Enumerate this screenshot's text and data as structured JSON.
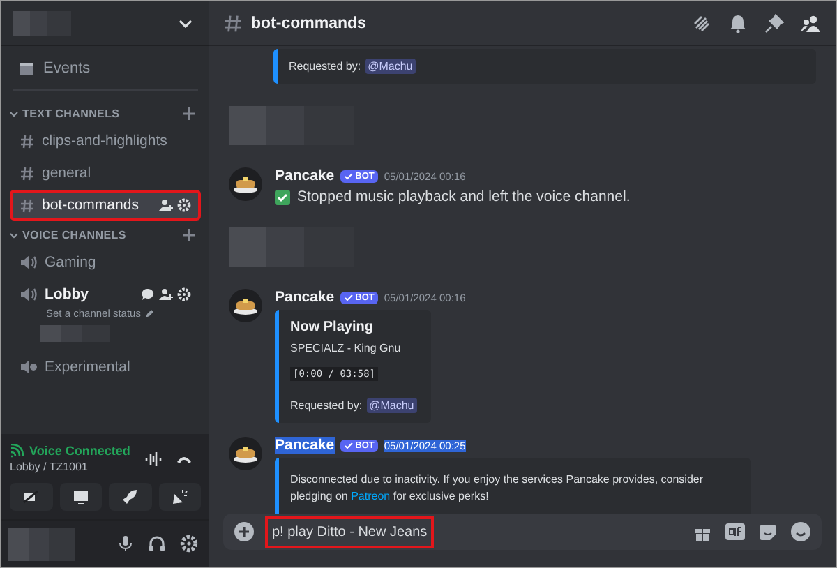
{
  "sidebar": {
    "events": "Events",
    "categories": [
      {
        "label": "TEXT CHANNELS",
        "channels": [
          {
            "kind": "text",
            "name": "clips-and-highlights",
            "selected": false,
            "highlighted": false,
            "connected": false
          },
          {
            "kind": "text",
            "name": "general",
            "selected": false,
            "highlighted": false,
            "connected": false
          },
          {
            "kind": "text",
            "name": "bot-commands",
            "selected": true,
            "highlighted": true,
            "connected": false
          }
        ]
      },
      {
        "label": "VOICE CHANNELS",
        "channels": [
          {
            "kind": "voice",
            "name": "Gaming",
            "selected": false,
            "highlighted": false,
            "connected": false
          },
          {
            "kind": "voice",
            "name": "Lobby",
            "selected": false,
            "highlighted": false,
            "connected": true,
            "status": "Set a channel status"
          },
          {
            "kind": "stage",
            "name": "Experimental",
            "selected": false,
            "highlighted": false,
            "connected": false
          }
        ]
      }
    ]
  },
  "voice_panel": {
    "status": "Voice Connected",
    "location": "Lobby / TZ1001"
  },
  "header": {
    "channel": "bot-commands"
  },
  "messages": [
    {
      "kind": "embed_tail",
      "label": "Requested by:",
      "mention": "@Machu"
    },
    {
      "kind": "hidden"
    },
    {
      "kind": "bot",
      "author": "Pancake",
      "badge": "BOT",
      "time": "05/01/2024 00:16",
      "text_selected": false,
      "content": "Stopped music playback and left the voice channel."
    },
    {
      "kind": "hidden"
    },
    {
      "kind": "bot",
      "author": "Pancake",
      "badge": "BOT",
      "time": "05/01/2024 00:16",
      "text_selected": false,
      "embed": {
        "title": "Now Playing",
        "track": "SPECIALZ - King Gnu",
        "progress": "[0:00 / 03:58]",
        "label": "Requested by:",
        "mention": "@Machu"
      }
    },
    {
      "kind": "bot",
      "author": "Pancake",
      "badge": "BOT",
      "time": "05/01/2024 00:25",
      "text_selected": true,
      "embed": {
        "before": "Disconnected due to inactivity. If you enjoy the services Pancake provides, consider pledging on ",
        "link": "Patreon",
        "after": " for exclusive perks!"
      }
    }
  ],
  "composer": {
    "value": "p! play Ditto - New Jeans",
    "highlighted": true
  }
}
